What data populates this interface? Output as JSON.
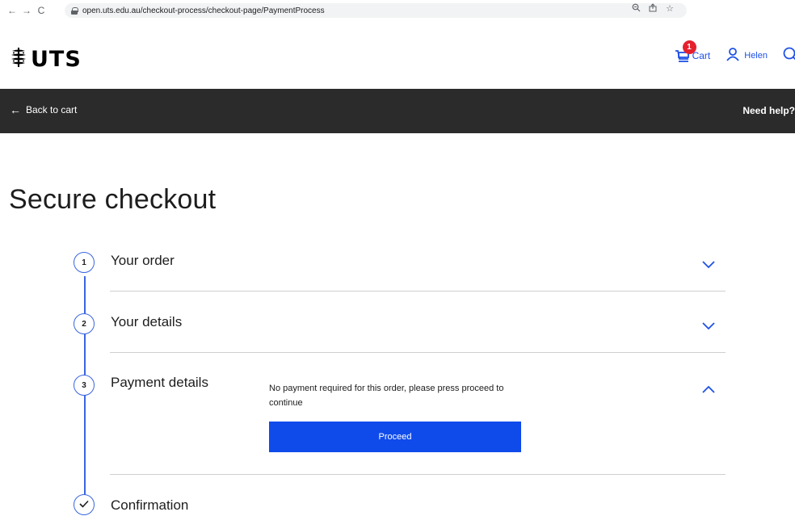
{
  "browser": {
    "url": "open.uts.edu.au/checkout-process/checkout-page/PaymentProcess"
  },
  "header": {
    "logo_text": "UTS",
    "cart_count": "1",
    "cart_label": "Cart",
    "user_label": "Helen"
  },
  "nav_bar": {
    "back_label": "Back to cart",
    "help_label": "Need help?"
  },
  "page": {
    "title": "Secure checkout"
  },
  "steps": [
    {
      "number": "1",
      "title": "Your order",
      "state": "collapsed"
    },
    {
      "number": "2",
      "title": "Your details",
      "state": "collapsed"
    },
    {
      "number": "3",
      "title": "Payment details",
      "state": "expanded"
    },
    {
      "number": "✓",
      "title": "Confirmation",
      "state": "pending"
    }
  ],
  "payment": {
    "note": "No payment required for this order, please press proceed to continue",
    "button_label": "Proceed"
  },
  "colors": {
    "accent": "#0f4beb",
    "dark_bar": "#2b2b2b",
    "badge": "#e5202d",
    "step_line": "#3a66e0"
  }
}
